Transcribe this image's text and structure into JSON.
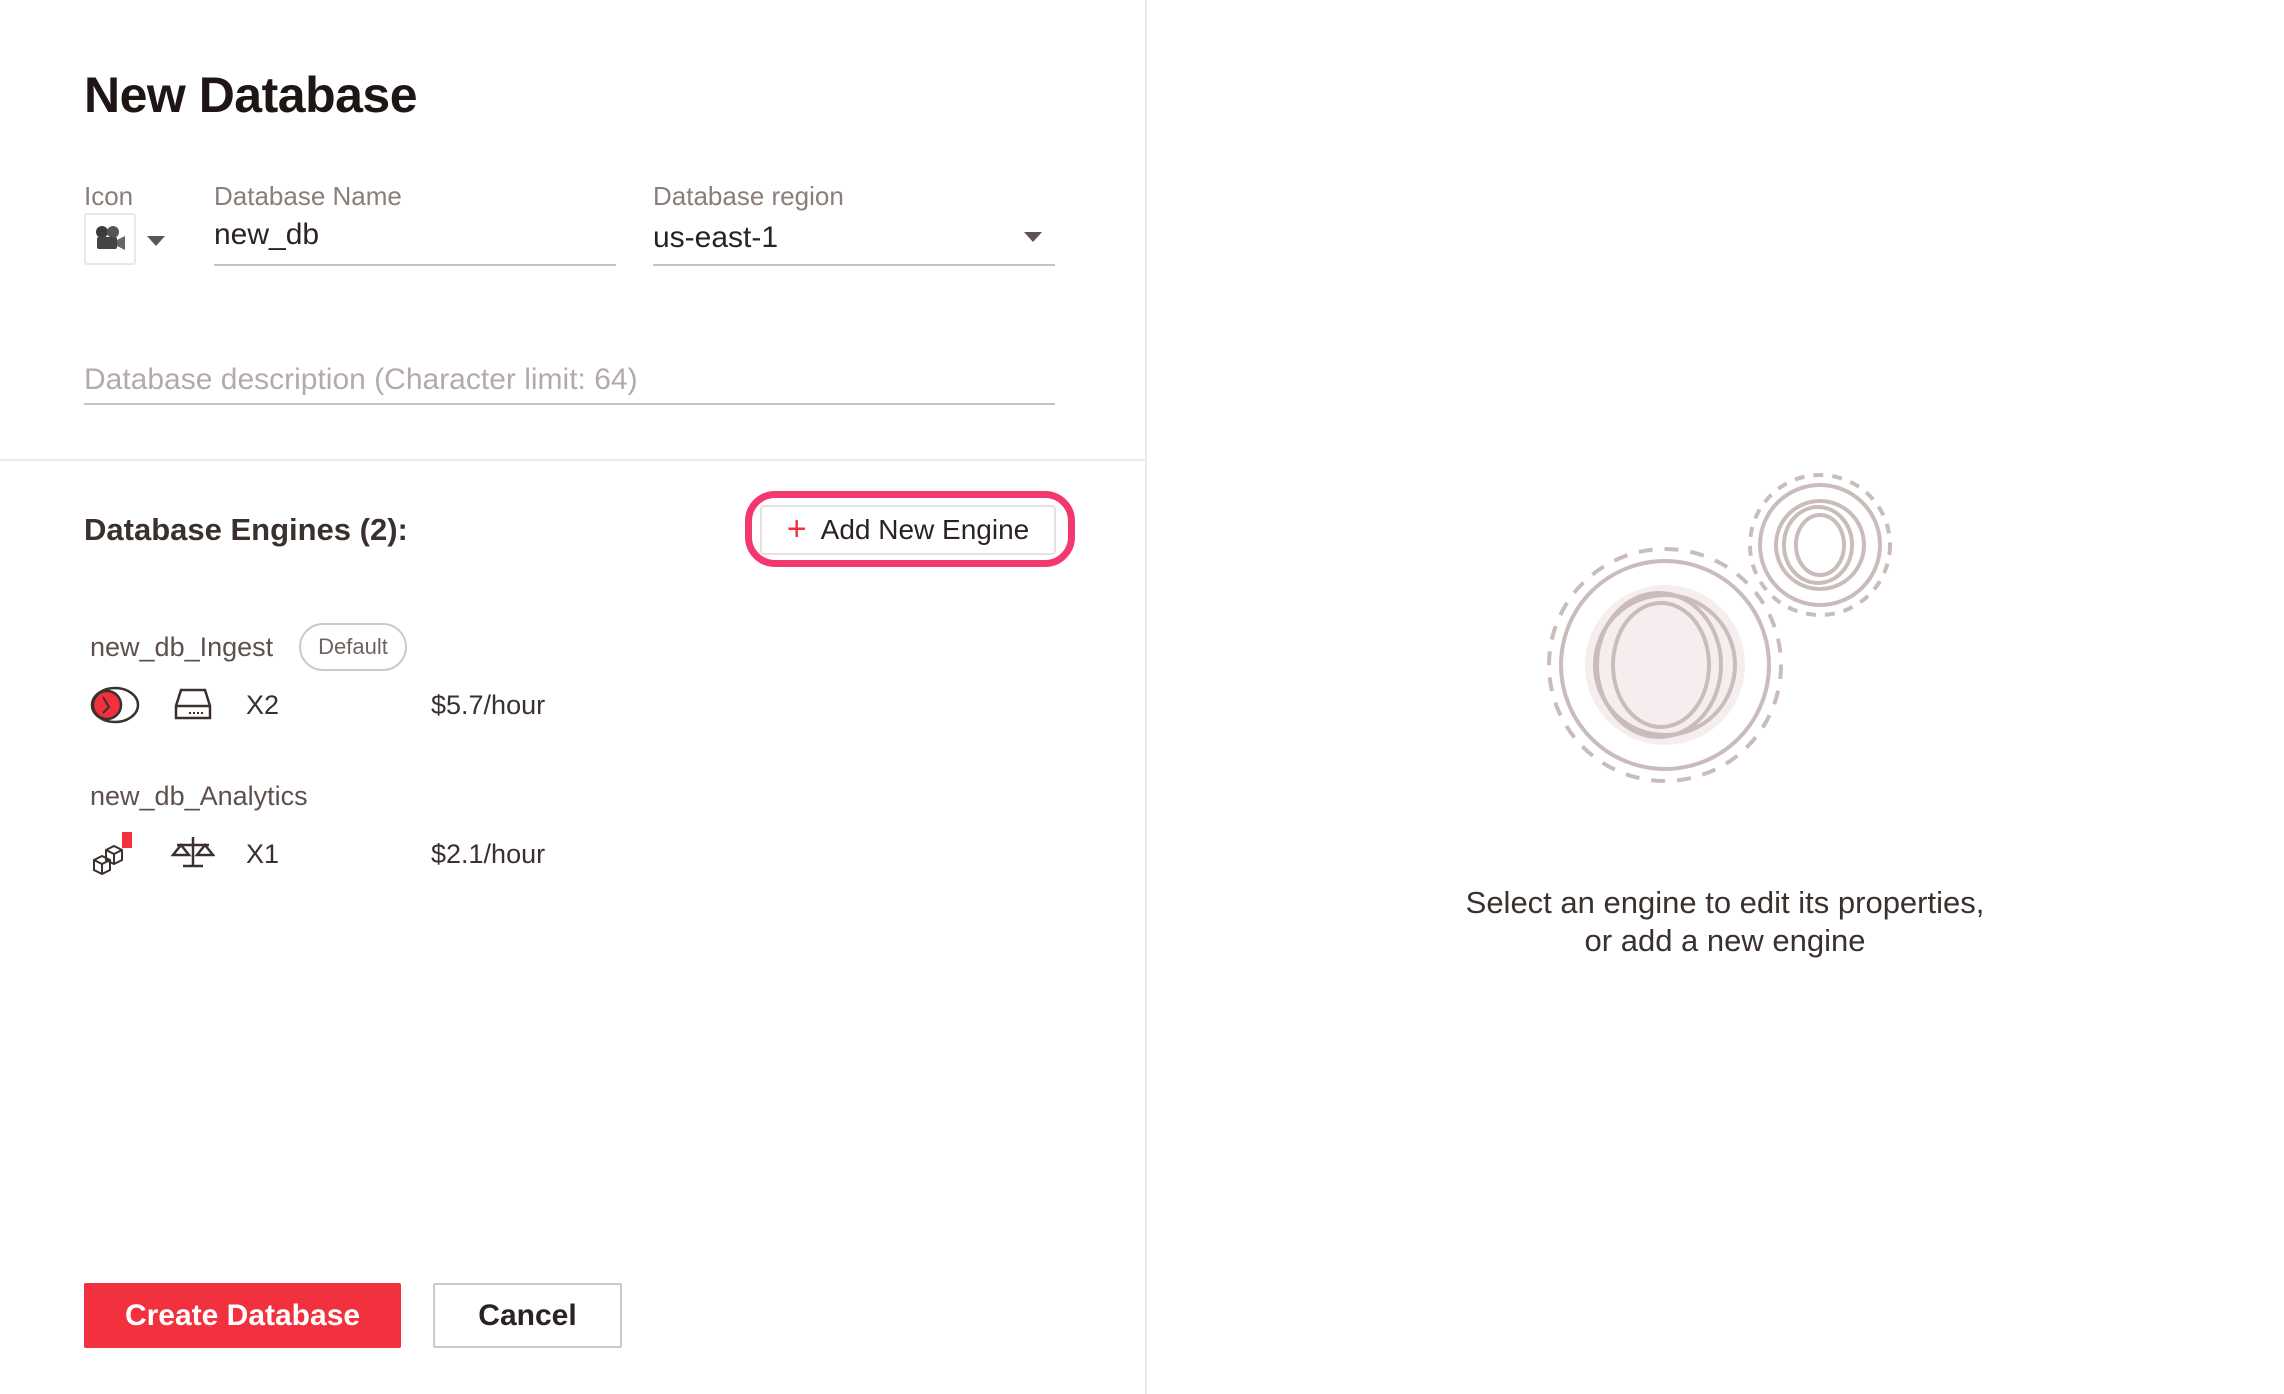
{
  "page": {
    "title": "New Database"
  },
  "form": {
    "icon_label": "Icon",
    "name_label": "Database Name",
    "name_value": "new_db",
    "region_label": "Database region",
    "region_value": "us-east-1",
    "description_placeholder": "Database description (Character limit: 64)"
  },
  "engines": {
    "heading": "Database Engines (2):",
    "add_button": "Add New Engine",
    "items": [
      {
        "name": "new_db_Ingest",
        "badge": "Default",
        "type_icon": "ingest-engine-icon",
        "spec_icon": "storage-drive-icon",
        "count": "X2",
        "price": "$5.7/hour"
      },
      {
        "name": "new_db_Analytics",
        "type_icon": "analytics-cubes-icon",
        "spec_icon": "balance-scale-icon",
        "count": "X1",
        "price": "$2.1/hour"
      }
    ]
  },
  "actions": {
    "create": "Create Database",
    "cancel": "Cancel"
  },
  "empty_state": {
    "line1": "Select an engine to edit its properties,",
    "line2": "or add a new engine",
    "icon": "gears-icon"
  },
  "colors": {
    "accent": "#f2313f",
    "highlight": "#f2386e"
  }
}
